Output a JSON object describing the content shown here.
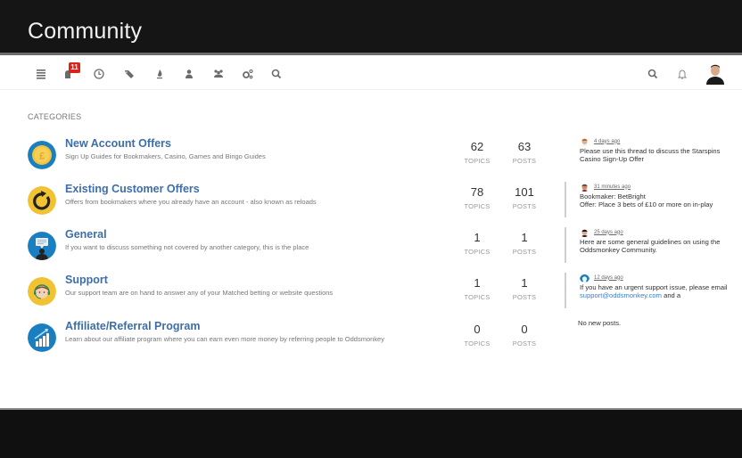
{
  "header": {
    "title": "Community"
  },
  "nav": {
    "left_icons": [
      {
        "name": "categories-list-icon"
      },
      {
        "name": "unread-icon",
        "badge": "11"
      },
      {
        "name": "recent-clock-icon"
      },
      {
        "name": "tags-icon"
      },
      {
        "name": "popular-fire-icon"
      },
      {
        "name": "user-icon"
      },
      {
        "name": "groups-icon"
      },
      {
        "name": "admin-cogs-icon"
      },
      {
        "name": "search-icon"
      }
    ],
    "right_icons": [
      {
        "name": "search-icon"
      },
      {
        "name": "notifications-bell-icon"
      },
      {
        "name": "user-avatar"
      }
    ],
    "unread_badge": "11"
  },
  "section_heading": "CATEGORIES",
  "categories": [
    {
      "name": "New Account Offers",
      "description": "Sign Up Guides for Bookmakers, Casino, Games and Bingo Guides",
      "icon": "pound-coin-icon",
      "topics": "62",
      "topics_label": "TOPICS",
      "posts": "63",
      "posts_label": "POSTS",
      "recent": {
        "time": "4 days ago",
        "text": "Please use this thread to discuss the Starspins Casino Sign-Up Offer"
      }
    },
    {
      "name": "Existing Customer Offers",
      "description": "Offers from bookmakers where you already have an account - also known as reloads",
      "icon": "reload-icon",
      "topics": "78",
      "topics_label": "TOPICS",
      "posts": "101",
      "posts_label": "POSTS",
      "recent": {
        "time": "31 minutes ago",
        "text_line1": "Bookmaker: BetBright",
        "text_line2": "Offer: Place 3 bets of £10 or more on in-play"
      }
    },
    {
      "name": "General",
      "description": "If you want to discuss something not covered by another category, this is the place",
      "icon": "speech-person-icon",
      "topics": "1",
      "topics_label": "TOPICS",
      "posts": "1",
      "posts_label": "POSTS",
      "recent": {
        "time": "25 days ago",
        "text": "Here are some general guidelines on using the Oddsmonkey Community."
      }
    },
    {
      "name": "Support",
      "description": "Our support team are on hand to answer any of your Matched betting or website questions",
      "icon": "headset-agent-icon",
      "topics": "1",
      "topics_label": "TOPICS",
      "posts": "1",
      "posts_label": "POSTS",
      "recent": {
        "time": "12 days ago",
        "text_before": "If you have an urgent support issue, please email ",
        "link": "support@oddsmonkey.com",
        "text_after": " and a"
      }
    },
    {
      "name": "Affiliate/Referral Program",
      "description": "Learn about our affiliate program where you can earn even more money by referring people to Oddsmonkey",
      "icon": "growth-chart-icon",
      "topics": "0",
      "topics_label": "TOPICS",
      "posts": "0",
      "posts_label": "POSTS",
      "recent": {
        "none": "No new posts."
      }
    }
  ],
  "colors": {
    "header_bg": "#151515",
    "link": "#3d6ea8",
    "badge": "#d9231d",
    "footer_bg": "#101010"
  }
}
